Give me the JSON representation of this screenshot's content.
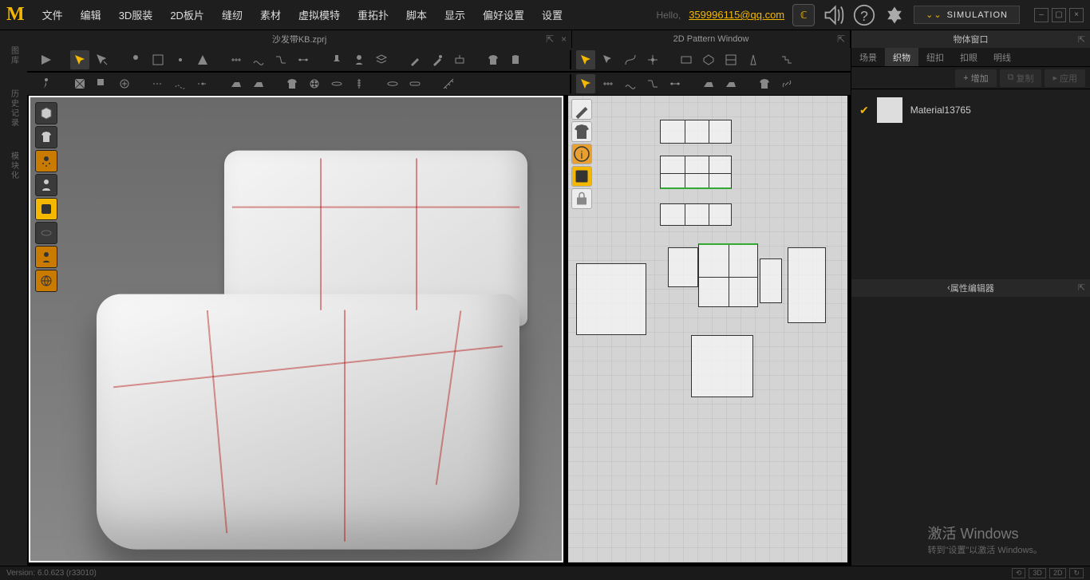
{
  "menu": {
    "items": [
      "文件",
      "编辑",
      "3D服装",
      "2D板片",
      "缝纫",
      "素材",
      "虚拟模特",
      "重拓扑",
      "脚本",
      "显示",
      "偏好设置",
      "设置"
    ]
  },
  "header": {
    "hello": "Hello,",
    "user": "359996115@qq.com",
    "sim_button": "SIMULATION"
  },
  "tabs": {
    "view3d_filename": "沙发带KB.zprj",
    "view2d_title": "2D Pattern Window",
    "right_title": "物体窗口"
  },
  "right": {
    "tabs": [
      "场景",
      "织物",
      "纽扣",
      "扣眼",
      "明线"
    ],
    "active_tab_index": 1,
    "actions": {
      "add": "增加",
      "copy": "复制",
      "apply": "应用"
    },
    "material_name": "Material13765",
    "property_editor": "属性编辑器"
  },
  "watermark": {
    "line1": "激活 Windows",
    "line2": "转到\"设置\"以激活 Windows。"
  },
  "status": {
    "version_label": "Version: 6.0.623 (r33010)",
    "modes": [
      "3D",
      "2D"
    ]
  }
}
